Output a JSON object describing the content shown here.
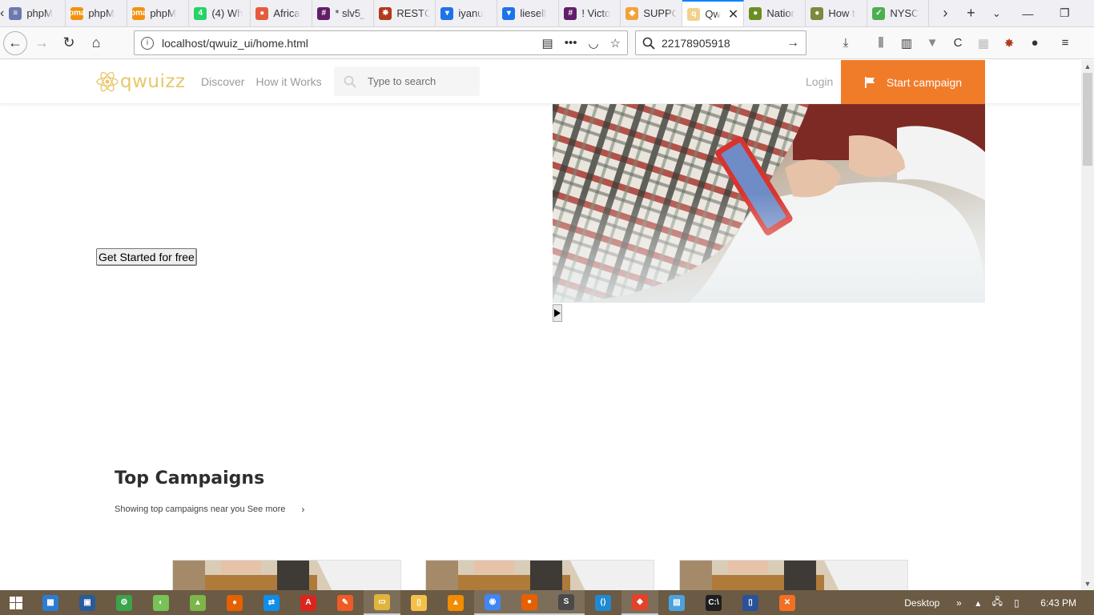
{
  "browser": {
    "tabs": [
      {
        "title": "phpM",
        "favicon_color": "#6c78af",
        "favicon_glyph": "≡"
      },
      {
        "title": "phpM",
        "favicon_color": "#f29111",
        "favicon_glyph": "pma"
      },
      {
        "title": "phpM",
        "favicon_color": "#f29111",
        "favicon_glyph": "pma"
      },
      {
        "title": "(4) Wh",
        "favicon_color": "#25d366",
        "favicon_glyph": "4"
      },
      {
        "title": "Africa",
        "favicon_color": "#e55b3c",
        "favicon_glyph": "●"
      },
      {
        "title": "* slv5_",
        "favicon_color": "#611f69",
        "favicon_glyph": "#"
      },
      {
        "title": "RESTC",
        "favicon_color": "#b33a1a",
        "favicon_glyph": "✸"
      },
      {
        "title": "iyanu",
        "favicon_color": "#1f73e8",
        "favicon_glyph": "▾"
      },
      {
        "title": "liesell",
        "favicon_color": "#1f73e8",
        "favicon_glyph": "▾"
      },
      {
        "title": "! Victo",
        "favicon_color": "#611f69",
        "favicon_glyph": "#"
      },
      {
        "title": "SUPPO",
        "favicon_color": "#f2a23a",
        "favicon_glyph": "◆"
      },
      {
        "title": "Qw",
        "favicon_color": "#f1d28c",
        "favicon_glyph": "q",
        "active": true
      },
      {
        "title": "Natior",
        "favicon_color": "#6b8e23",
        "favicon_glyph": "●"
      },
      {
        "title": "How t",
        "favicon_color": "#7a8b3f",
        "favicon_glyph": "●"
      },
      {
        "title": "NYSC",
        "favicon_color": "#4caf50",
        "favicon_glyph": "✓"
      }
    ],
    "url": "localhost/qwuiz_ui/home.html",
    "search_value": "22178905918"
  },
  "site": {
    "logo_text": "qwuizz",
    "nav": [
      "Discover",
      "How it Works"
    ],
    "search_placeholder": "Type to search",
    "login_label": "Login",
    "cta_label": "Start campaign",
    "accent_color": "#f07c2a",
    "logo_color": "#e8c76a"
  },
  "hero": {
    "button_label": "Get Started for free"
  },
  "campaigns": {
    "title": "Top Campaigns",
    "subtitle": "Showing top campaigns near you See more"
  },
  "taskbar": {
    "apps": [
      {
        "name": "windows-store",
        "color": "#2b7cd3",
        "glyph": "▦"
      },
      {
        "name": "photos",
        "color": "#2a5b99",
        "glyph": "▣"
      },
      {
        "name": "chrome-app",
        "color": "#3ca34b",
        "glyph": "⚙"
      },
      {
        "name": "android-sdk",
        "color": "#78c257",
        "glyph": "◐"
      },
      {
        "name": "android-studio",
        "color": "#7ab648",
        "glyph": "▲"
      },
      {
        "name": "firefox",
        "color": "#e66000",
        "glyph": "●"
      },
      {
        "name": "teamviewer",
        "color": "#0e8ee9",
        "glyph": "⇄"
      },
      {
        "name": "acrobat",
        "color": "#d9261c",
        "glyph": "A"
      },
      {
        "name": "postman",
        "color": "#ef5b25",
        "glyph": "✎"
      },
      {
        "name": "file-manager",
        "color": "#e1b43c",
        "glyph": "▭",
        "open": true
      },
      {
        "name": "explorer",
        "color": "#f3c14a",
        "glyph": "▯"
      },
      {
        "name": "vlc",
        "color": "#f28c00",
        "glyph": "▲"
      },
      {
        "name": "chrome",
        "color": "#4285f4",
        "glyph": "◉",
        "open": true
      },
      {
        "name": "firefox-active",
        "color": "#e66000",
        "glyph": "●",
        "open": true
      },
      {
        "name": "sublime",
        "color": "#4a4a4a",
        "glyph": "S",
        "open": true
      },
      {
        "name": "vscode",
        "color": "#1f8ad2",
        "glyph": "⟨⟩"
      },
      {
        "name": "git",
        "color": "#e24329",
        "glyph": "◆",
        "open": true
      },
      {
        "name": "remote-desktop",
        "color": "#4aa3df",
        "glyph": "▤"
      },
      {
        "name": "cmd",
        "color": "#1e1e1e",
        "glyph": "C:\\"
      },
      {
        "name": "phpstorm",
        "color": "#2a5298",
        "glyph": "▯"
      },
      {
        "name": "xampp",
        "color": "#f37023",
        "glyph": "✕"
      }
    ],
    "tray_label": "Desktop",
    "clock": "6:43 PM"
  }
}
